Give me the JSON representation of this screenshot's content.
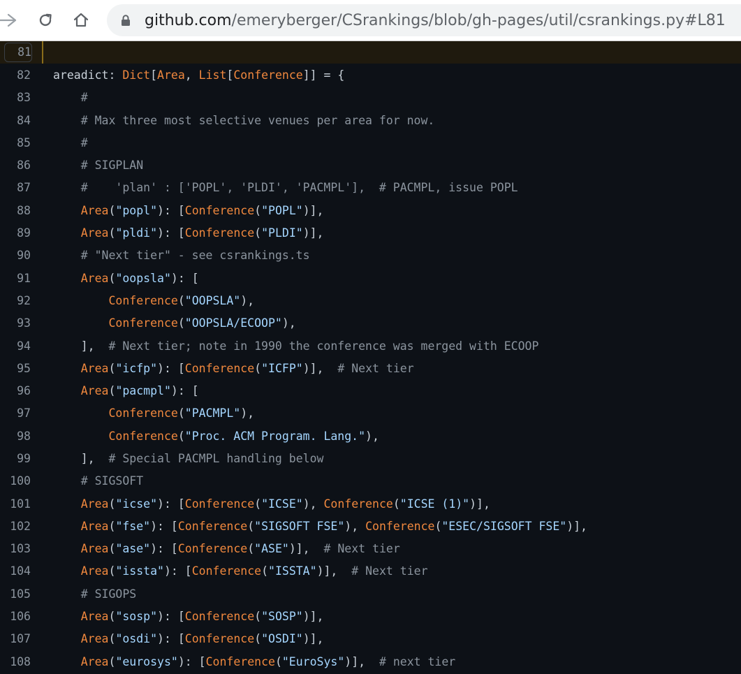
{
  "browser": {
    "url_host": "github.com",
    "url_path": "/emeryberger/CSrankings/blob/gh-pages/util/csrankings.py#L81",
    "icons": [
      "back-arrow-icon",
      "reload-icon",
      "home-icon",
      "lock-icon"
    ]
  },
  "code": {
    "highlight_line": "81",
    "lines": [
      {
        "n": "81",
        "tokens": []
      },
      {
        "n": "82",
        "tokens": [
          [
            "p",
            "areadict: "
          ],
          [
            "k",
            "Dict"
          ],
          [
            "p",
            "["
          ],
          [
            "k",
            "Area"
          ],
          [
            "p",
            ", "
          ],
          [
            "k",
            "List"
          ],
          [
            "p",
            "["
          ],
          [
            "k",
            "Conference"
          ],
          [
            "p",
            "]] = {"
          ]
        ]
      },
      {
        "n": "83",
        "tokens": [
          [
            "c",
            "    #"
          ]
        ]
      },
      {
        "n": "84",
        "tokens": [
          [
            "c",
            "    # Max three most selective venues per area for now."
          ]
        ]
      },
      {
        "n": "85",
        "tokens": [
          [
            "c",
            "    #"
          ]
        ]
      },
      {
        "n": "86",
        "tokens": [
          [
            "c",
            "    # SIGPLAN"
          ]
        ]
      },
      {
        "n": "87",
        "tokens": [
          [
            "c",
            "    #    'plan' : ['POPL', 'PLDI', 'PACMPL'],  # PACMPL, issue POPL"
          ]
        ]
      },
      {
        "n": "88",
        "tokens": [
          [
            "p",
            "    "
          ],
          [
            "k",
            "Area"
          ],
          [
            "p",
            "("
          ],
          [
            "s",
            "\"popl\""
          ],
          [
            "p",
            "): ["
          ],
          [
            "k",
            "Conference"
          ],
          [
            "p",
            "("
          ],
          [
            "s",
            "\"POPL\""
          ],
          [
            "p",
            ")],"
          ]
        ]
      },
      {
        "n": "89",
        "tokens": [
          [
            "p",
            "    "
          ],
          [
            "k",
            "Area"
          ],
          [
            "p",
            "("
          ],
          [
            "s",
            "\"pldi\""
          ],
          [
            "p",
            "): ["
          ],
          [
            "k",
            "Conference"
          ],
          [
            "p",
            "("
          ],
          [
            "s",
            "\"PLDI\""
          ],
          [
            "p",
            ")],"
          ]
        ]
      },
      {
        "n": "90",
        "tokens": [
          [
            "c",
            "    # \"Next tier\" - see csrankings.ts"
          ]
        ]
      },
      {
        "n": "91",
        "tokens": [
          [
            "p",
            "    "
          ],
          [
            "k",
            "Area"
          ],
          [
            "p",
            "("
          ],
          [
            "s",
            "\"oopsla\""
          ],
          [
            "p",
            "): ["
          ]
        ]
      },
      {
        "n": "92",
        "tokens": [
          [
            "p",
            "        "
          ],
          [
            "k",
            "Conference"
          ],
          [
            "p",
            "("
          ],
          [
            "s",
            "\"OOPSLA\""
          ],
          [
            "p",
            "),"
          ]
        ]
      },
      {
        "n": "93",
        "tokens": [
          [
            "p",
            "        "
          ],
          [
            "k",
            "Conference"
          ],
          [
            "p",
            "("
          ],
          [
            "s",
            "\"OOPSLA/ECOOP\""
          ],
          [
            "p",
            "),"
          ]
        ]
      },
      {
        "n": "94",
        "tokens": [
          [
            "p",
            "    ],  "
          ],
          [
            "c",
            "# Next tier; note in 1990 the conference was merged with ECOOP"
          ]
        ]
      },
      {
        "n": "95",
        "tokens": [
          [
            "p",
            "    "
          ],
          [
            "k",
            "Area"
          ],
          [
            "p",
            "("
          ],
          [
            "s",
            "\"icfp\""
          ],
          [
            "p",
            "): ["
          ],
          [
            "k",
            "Conference"
          ],
          [
            "p",
            "("
          ],
          [
            "s",
            "\"ICFP\""
          ],
          [
            "p",
            ")],  "
          ],
          [
            "c",
            "# Next tier"
          ]
        ]
      },
      {
        "n": "96",
        "tokens": [
          [
            "p",
            "    "
          ],
          [
            "k",
            "Area"
          ],
          [
            "p",
            "("
          ],
          [
            "s",
            "\"pacmpl\""
          ],
          [
            "p",
            "): ["
          ]
        ]
      },
      {
        "n": "97",
        "tokens": [
          [
            "p",
            "        "
          ],
          [
            "k",
            "Conference"
          ],
          [
            "p",
            "("
          ],
          [
            "s",
            "\"PACMPL\""
          ],
          [
            "p",
            "),"
          ]
        ]
      },
      {
        "n": "98",
        "tokens": [
          [
            "p",
            "        "
          ],
          [
            "k",
            "Conference"
          ],
          [
            "p",
            "("
          ],
          [
            "s",
            "\"Proc. ACM Program. Lang.\""
          ],
          [
            "p",
            "),"
          ]
        ]
      },
      {
        "n": "99",
        "tokens": [
          [
            "p",
            "    ],  "
          ],
          [
            "c",
            "# Special PACMPL handling below"
          ]
        ]
      },
      {
        "n": "100",
        "tokens": [
          [
            "c",
            "    # SIGSOFT"
          ]
        ]
      },
      {
        "n": "101",
        "tokens": [
          [
            "p",
            "    "
          ],
          [
            "k",
            "Area"
          ],
          [
            "p",
            "("
          ],
          [
            "s",
            "\"icse\""
          ],
          [
            "p",
            "): ["
          ],
          [
            "k",
            "Conference"
          ],
          [
            "p",
            "("
          ],
          [
            "s",
            "\"ICSE\""
          ],
          [
            "p",
            "), "
          ],
          [
            "k",
            "Conference"
          ],
          [
            "p",
            "("
          ],
          [
            "s",
            "\"ICSE (1)\""
          ],
          [
            "p",
            ")],"
          ]
        ]
      },
      {
        "n": "102",
        "tokens": [
          [
            "p",
            "    "
          ],
          [
            "k",
            "Area"
          ],
          [
            "p",
            "("
          ],
          [
            "s",
            "\"fse\""
          ],
          [
            "p",
            "): ["
          ],
          [
            "k",
            "Conference"
          ],
          [
            "p",
            "("
          ],
          [
            "s",
            "\"SIGSOFT FSE\""
          ],
          [
            "p",
            "), "
          ],
          [
            "k",
            "Conference"
          ],
          [
            "p",
            "("
          ],
          [
            "s",
            "\"ESEC/SIGSOFT FSE\""
          ],
          [
            "p",
            ")],"
          ]
        ]
      },
      {
        "n": "103",
        "tokens": [
          [
            "p",
            "    "
          ],
          [
            "k",
            "Area"
          ],
          [
            "p",
            "("
          ],
          [
            "s",
            "\"ase\""
          ],
          [
            "p",
            "): ["
          ],
          [
            "k",
            "Conference"
          ],
          [
            "p",
            "("
          ],
          [
            "s",
            "\"ASE\""
          ],
          [
            "p",
            ")],  "
          ],
          [
            "c",
            "# Next tier"
          ]
        ]
      },
      {
        "n": "104",
        "tokens": [
          [
            "p",
            "    "
          ],
          [
            "k",
            "Area"
          ],
          [
            "p",
            "("
          ],
          [
            "s",
            "\"issta\""
          ],
          [
            "p",
            "): ["
          ],
          [
            "k",
            "Conference"
          ],
          [
            "p",
            "("
          ],
          [
            "s",
            "\"ISSTA\""
          ],
          [
            "p",
            ")],  "
          ],
          [
            "c",
            "# Next tier"
          ]
        ]
      },
      {
        "n": "105",
        "tokens": [
          [
            "c",
            "    # SIGOPS"
          ]
        ]
      },
      {
        "n": "106",
        "tokens": [
          [
            "p",
            "    "
          ],
          [
            "k",
            "Area"
          ],
          [
            "p",
            "("
          ],
          [
            "s",
            "\"sosp\""
          ],
          [
            "p",
            "): ["
          ],
          [
            "k",
            "Conference"
          ],
          [
            "p",
            "("
          ],
          [
            "s",
            "\"SOSP\""
          ],
          [
            "p",
            ")],"
          ]
        ]
      },
      {
        "n": "107",
        "tokens": [
          [
            "p",
            "    "
          ],
          [
            "k",
            "Area"
          ],
          [
            "p",
            "("
          ],
          [
            "s",
            "\"osdi\""
          ],
          [
            "p",
            "): ["
          ],
          [
            "k",
            "Conference"
          ],
          [
            "p",
            "("
          ],
          [
            "s",
            "\"OSDI\""
          ],
          [
            "p",
            ")],"
          ]
        ]
      },
      {
        "n": "108",
        "tokens": [
          [
            "p",
            "    "
          ],
          [
            "k",
            "Area"
          ],
          [
            "p",
            "("
          ],
          [
            "s",
            "\"eurosys\""
          ],
          [
            "p",
            "): ["
          ],
          [
            "k",
            "Conference"
          ],
          [
            "p",
            "("
          ],
          [
            "s",
            "\"EuroSys\""
          ],
          [
            "p",
            ")],  "
          ],
          [
            "c",
            "# next tier"
          ]
        ]
      }
    ]
  }
}
